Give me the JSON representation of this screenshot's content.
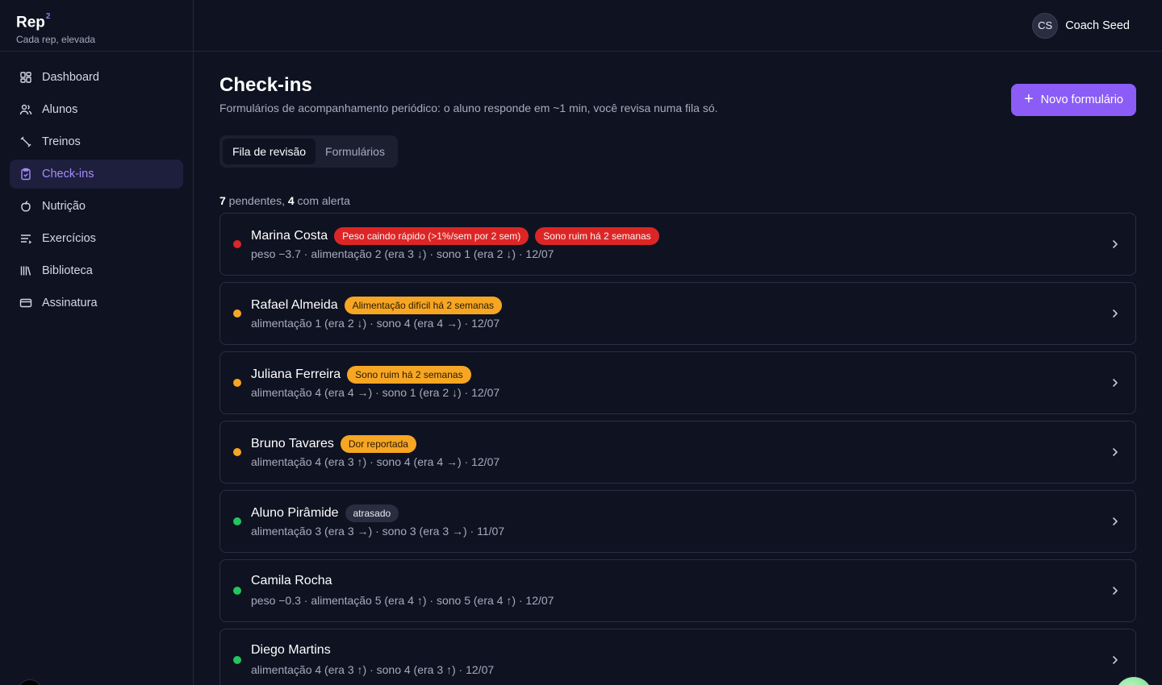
{
  "brand": {
    "name": "Rep",
    "sup": "2",
    "tagline": "Cada rep, elevada"
  },
  "nav": [
    {
      "label": "Dashboard",
      "icon": "dashboard-icon",
      "active": false
    },
    {
      "label": "Alunos",
      "icon": "users-icon",
      "active": false
    },
    {
      "label": "Treinos",
      "icon": "workout-icon",
      "active": false
    },
    {
      "label": "Check-ins",
      "icon": "clipboard-check-icon",
      "active": true
    },
    {
      "label": "Nutrição",
      "icon": "apple-icon",
      "active": false
    },
    {
      "label": "Exercícios",
      "icon": "list-icon",
      "active": false
    },
    {
      "label": "Biblioteca",
      "icon": "library-icon",
      "active": false
    },
    {
      "label": "Assinatura",
      "icon": "credit-card-icon",
      "active": false
    }
  ],
  "user": {
    "initials": "CS",
    "name": "Coach Seed"
  },
  "page": {
    "title": "Check-ins",
    "subtitle": "Formulários de acompanhamento periódico: o aluno responde em ~1 min, você revisa numa fila só.",
    "new_button": "Novo formulário"
  },
  "tabs": [
    {
      "label": "Fila de revisão",
      "active": true
    },
    {
      "label": "Formulários",
      "active": false
    }
  ],
  "summary": {
    "pending": "7",
    "pending_label": " pendentes, ",
    "alerts": "4",
    "alerts_label": " com alerta"
  },
  "colors": {
    "red": "#dc2626",
    "yellow": "#f6a623",
    "green": "#22c55e",
    "accent": "#8b5cf6"
  },
  "checkins": [
    {
      "name": "Marina Costa",
      "status": "red",
      "badges": [
        {
          "text": "Peso caindo rápido (>1%/sem por 2 sem)",
          "tone": "red"
        },
        {
          "text": "Sono ruim há 2 semanas",
          "tone": "red"
        }
      ],
      "detail": "peso −3.7 · alimentação 2 (era 3 ↓) · sono 1 (era 2 ↓) · 12/07"
    },
    {
      "name": "Rafael Almeida",
      "status": "yellow",
      "badges": [
        {
          "text": "Alimentação difícil há 2 semanas",
          "tone": "yellow"
        }
      ],
      "detail": "alimentação 1 (era 2 ↓) · sono 4 (era 4 →) · 12/07"
    },
    {
      "name": "Juliana Ferreira",
      "status": "yellow",
      "badges": [
        {
          "text": "Sono ruim há 2 semanas",
          "tone": "yellow"
        }
      ],
      "detail": "alimentação 4 (era 4 →) · sono 1 (era 2 ↓) · 12/07"
    },
    {
      "name": "Bruno Tavares",
      "status": "yellow",
      "badges": [
        {
          "text": "Dor reportada",
          "tone": "yellow"
        }
      ],
      "detail": "alimentação 4 (era 3 ↑) · sono 4 (era 4 →) · 12/07"
    },
    {
      "name": "Aluno Pirâmide",
      "status": "green",
      "badges": [
        {
          "text": "atrasado",
          "tone": "gray"
        }
      ],
      "detail": "alimentação 3 (era 3 →) · sono 3 (era 3 →) · 11/07"
    },
    {
      "name": "Camila Rocha",
      "status": "green",
      "badges": [],
      "detail": "peso −0.3 · alimentação 5 (era 4 ↑) · sono 5 (era 4 ↑) · 12/07"
    },
    {
      "name": "Diego Martins",
      "status": "green",
      "badges": [],
      "detail": "alimentação 4 (era 3 ↑) · sono 4 (era 3 ↑) · 12/07"
    }
  ]
}
